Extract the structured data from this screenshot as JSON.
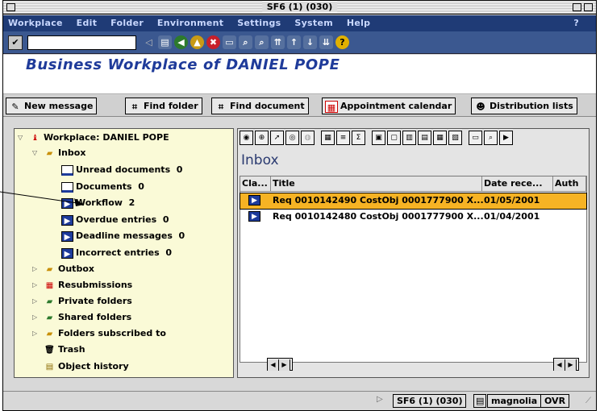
{
  "window": {
    "title": "SF6 (1) (030)"
  },
  "menu": {
    "items": [
      "Workplace",
      "Edit",
      "Folder",
      "Environment",
      "Settings",
      "System",
      "Help"
    ],
    "help_glyph": "?"
  },
  "header": {
    "title": "Business Workplace of DANIEL POPE"
  },
  "app_toolbar": {
    "new_message": "New message",
    "find_folder": "Find folder",
    "find_document": "Find document",
    "appointment_calendar": "Appointment calendar",
    "distribution_lists": "Distribution lists"
  },
  "tree": {
    "root": "Workplace: DANIEL POPE",
    "inbox": "Inbox",
    "inbox_items": [
      {
        "label": "Unread documents",
        "count": "0"
      },
      {
        "label": "Documents",
        "count": "0"
      },
      {
        "label": "Workflow",
        "count": "2"
      },
      {
        "label": "Overdue entries",
        "count": "0"
      },
      {
        "label": "Deadline messages",
        "count": "0"
      },
      {
        "label": "Incorrect entries",
        "count": "0"
      }
    ],
    "folders": [
      "Outbox",
      "Resubmissions",
      "Private folders",
      "Shared folders",
      "Folders subscribed to",
      "Trash",
      "Object history"
    ]
  },
  "inbox_panel": {
    "title": "Inbox",
    "columns": [
      "Cla...",
      "Title",
      "Date rece...",
      "Auth"
    ],
    "rows": [
      {
        "title": "Req 0010142490 CostObj 0001777900 X...",
        "date": "01/05/2001",
        "selected": true
      },
      {
        "title": "Req 0010142480 CostObj 0001777900 X...",
        "date": "01/04/2001",
        "selected": false
      }
    ]
  },
  "status": {
    "system": "SF6 (1) (030)",
    "server": "magnolia",
    "mode": "OVR"
  },
  "colors": {
    "menu_bg": "#1f3b76",
    "selected_row": "#f6b324",
    "tree_bg": "#fafad7",
    "header_title": "#1f3b9a"
  }
}
